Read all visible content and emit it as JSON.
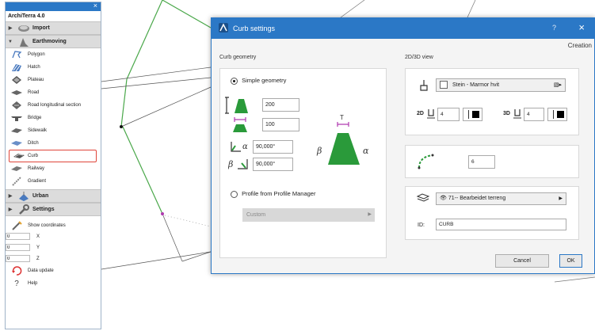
{
  "palette": {
    "app_title": "ArchiTerra 4.0",
    "close": "×",
    "groups": {
      "import": "Import",
      "earthmoving": "Earthmoving",
      "urban": "Urban",
      "settings": "Settings"
    },
    "items": [
      "Polygon",
      "Hatch",
      "Plateau",
      "Road",
      "Road longitudinal section",
      "Bridge",
      "Sidewalk",
      "Ditch",
      "Curb",
      "Railway",
      "Gradient"
    ],
    "show_coordinates": "Show coordinates",
    "coords": [
      {
        "value": "0",
        "label": "X"
      },
      {
        "value": "0",
        "label": "Y"
      },
      {
        "value": "0",
        "label": "Z"
      }
    ],
    "data_update": "Data update",
    "help": "Help"
  },
  "dialog": {
    "title": "Curb settings",
    "help": "?",
    "close": "×",
    "mode": "Creation",
    "geometry_label": "Curb geometry",
    "view_label": "2D/3D view",
    "simple_geometry": "Simple geometry",
    "height": "200",
    "top_width": "100",
    "alpha": "90,000°",
    "beta": "90,000°",
    "profile_option": "Profile from Profile Manager",
    "profile_select": "Custom",
    "material": "Stein - Marmor hvit",
    "pen_2d_label": "2D",
    "pen_2d": "4",
    "pen_3d_label": "3D",
    "pen_3d": "4",
    "segments": "6",
    "layer": "71-- Bearbeidet terreng",
    "id_label": "ID:",
    "id_value": "CURB",
    "cancel": "Cancel",
    "ok": "OK"
  },
  "colors": {
    "accent": "#2b78c6",
    "selection_outline": "#e0453a",
    "curb_icon": "#2a9a3a"
  }
}
